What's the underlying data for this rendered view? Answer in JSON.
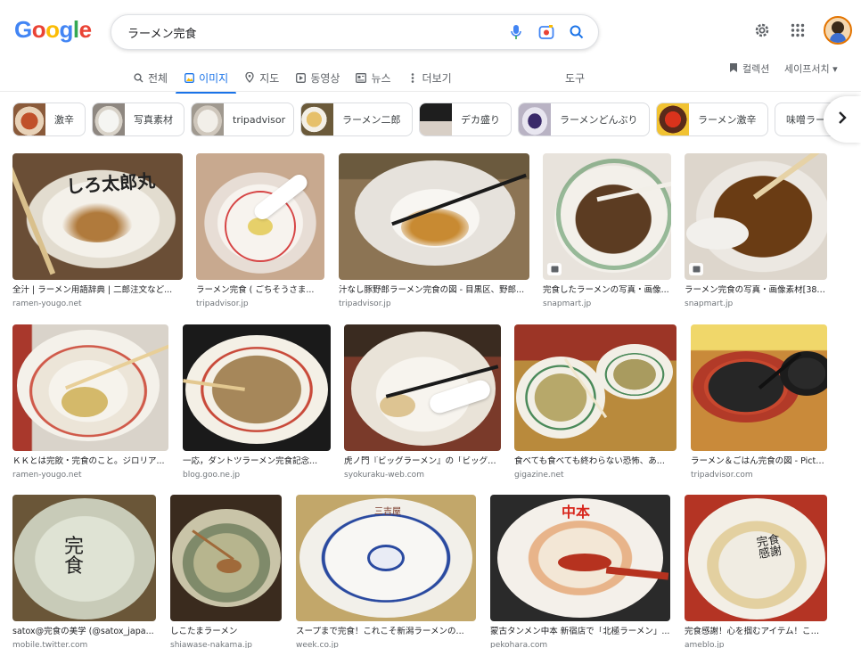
{
  "search": {
    "query": "ラーメン完食"
  },
  "tabs": [
    {
      "label": "전체",
      "icon": "search-icon"
    },
    {
      "label": "이미지",
      "icon": "image-icon"
    },
    {
      "label": "지도",
      "icon": "map-pin-icon"
    },
    {
      "label": "동영상",
      "icon": "video-icon"
    },
    {
      "label": "뉴스",
      "icon": "news-icon"
    },
    {
      "label": "더보기",
      "icon": "more-vert-icon"
    }
  ],
  "toolbar": {
    "tools_label": "도구",
    "saved_label": "컬렉션",
    "safesearch_label": "세이프서치 ▾"
  },
  "chips": [
    {
      "label": "激辛"
    },
    {
      "label": "写真素材"
    },
    {
      "label": "tripadvisor"
    },
    {
      "label": "ラーメン二郎"
    },
    {
      "label": "デカ盛り"
    },
    {
      "label": "ラーメンどんぶり"
    },
    {
      "label": "ラーメン激辛"
    },
    {
      "label": "味噌ラーメン"
    }
  ],
  "results": [
    {
      "caption": "全汁 | ラーメン用語辞典 | 二郎注文など...",
      "source": "ramen-yougo.net"
    },
    {
      "caption": "ラーメン完食 ( ごちそうさま...",
      "source": "tripadvisor.jp"
    },
    {
      "caption": "汁なし豚野郎ラーメン完食の図 - 目黒区、野郎...",
      "source": "tripadvisor.jp"
    },
    {
      "caption": "完食したラーメンの写真・画像...",
      "source": "snapmart.jp"
    },
    {
      "caption": "ラーメン完食の写真・画像素材[3875291]...",
      "source": "snapmart.jp"
    },
    {
      "caption": "ＫＫとは完飲・完食のこと。ジロリア...",
      "source": "ramen-yougo.net"
    },
    {
      "caption": "一応，ダントツラーメン完食記念...",
      "source": "blog.goo.ne.jp"
    },
    {
      "caption": "虎ノ門『ビッグラーメン』の「ビッグラ...",
      "source": "syokuraku-web.com"
    },
    {
      "caption": "食べても食べても終わらない恐怖、あ...",
      "source": "gigazine.net"
    },
    {
      "caption": "ラーメン＆ごはん完食の図 - Picture of...",
      "source": "tripadvisor.com"
    },
    {
      "caption": "satox@完食の美学 (@satox_japa...",
      "source": "mobile.twitter.com"
    },
    {
      "caption": "しこたまラーメン",
      "source": "shiawase-nakama.jp"
    },
    {
      "caption": "スープまで完食！これこそ新潟ラーメンの...",
      "source": "week.co.jp"
    },
    {
      "caption": "蒙古タンメン中本 新宿店で「北極ラーメン」...",
      "source": "pekohara.com"
    },
    {
      "caption": "完食感謝！心を掴むアイテム！これもモ...",
      "source": "ameblo.jp"
    }
  ],
  "colors": {
    "accent": "#1a73e8",
    "google_blue": "#4285f4",
    "google_red": "#ea4335",
    "google_yellow": "#fbbc05",
    "google_green": "#34a853"
  }
}
